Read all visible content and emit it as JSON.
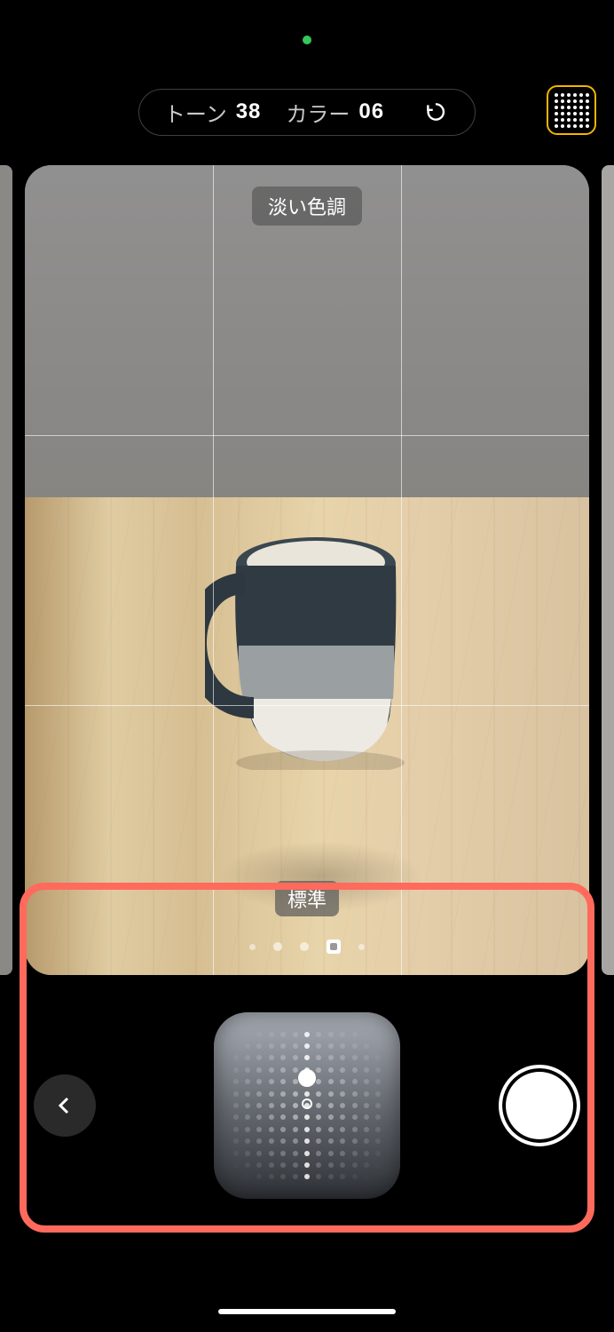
{
  "camera_indicator": "active",
  "top_pill": {
    "tone_label": "トーン",
    "tone_value": "38",
    "color_label": "カラー",
    "color_value": "06"
  },
  "grid_toggle_icon": "grid-icon",
  "viewfinder": {
    "style_name": "淡い色調",
    "mode_name": "標準",
    "style_index_active": 3,
    "style_count": 5
  },
  "controls": {
    "back_icon": "chevron-left-icon",
    "shutter_icon": "shutter-icon",
    "tone_pad_icon": "tone-color-pad"
  },
  "colors": {
    "annotation_border": "#ff6a5d",
    "grid_toggle_border": "#f5b400",
    "camera_indicator": "#35c759"
  }
}
